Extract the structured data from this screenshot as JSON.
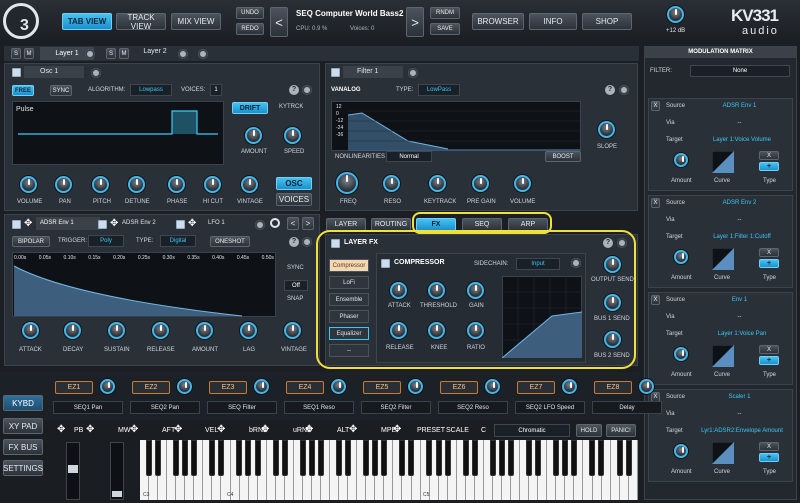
{
  "logo": {
    "badge": "3",
    "brand_top": "KV331",
    "brand_bottom": "audio"
  },
  "top": {
    "tab_view": "TAB VIEW",
    "track_view": "TRACK VIEW",
    "mix_view": "MIX VIEW",
    "undo": "UNDO",
    "redo": "REDO",
    "preset": "SEQ Computer World Bass2",
    "cpu": "CPU: 0.9 %",
    "voices": "Voices: 0",
    "rndm": "RNDM",
    "save": "SAVE",
    "browser": "BROWSER",
    "info": "INFO",
    "shop": "SHOP",
    "volume": "+12 dB"
  },
  "layers": {
    "s": "S",
    "m": "M",
    "layer1": "Layer 1",
    "layer2": "Layer 2"
  },
  "osc": {
    "title": "Osc 1",
    "free": "FREE",
    "sync": "SYNC",
    "algorithm_label": "ALGORITHM:",
    "algorithm": "Lowpass",
    "voices_label": "VOICES:",
    "voices": "1",
    "wave": "Pulse",
    "drift": "DRIFT",
    "kytrck": "KYTRCK",
    "amount": "AMOUNT",
    "speed": "SPEED",
    "knobs": [
      "VOLUME",
      "PAN",
      "PITCH",
      "DETUNE",
      "PHASE",
      "HI CUT",
      "VINTAGE"
    ],
    "osc_btn": "OSC",
    "voices_btn": "VOICES"
  },
  "filter": {
    "title": "Filter 1",
    "vanalog": "VANALOG",
    "type_label": "TYPE:",
    "type": "LowPass",
    "ticks": [
      "12",
      "0",
      "-12",
      "-24",
      "-36"
    ],
    "nonlin": "NONLINEARITIES",
    "normal": "Normal",
    "boost": "BOOST",
    "slope": "SLOPE",
    "knobs": [
      "FREQ",
      "RESO",
      "KEYTRACK",
      "PRE GAIN",
      "VOLUME"
    ]
  },
  "tabs": {
    "layer": "LAYER",
    "routing": "ROUTING",
    "fx": "FX",
    "seq": "SEQ",
    "arp": "ARP"
  },
  "env": {
    "env1": "ADSR Env 1",
    "env2": "ADSR Env 2",
    "lfo": "LFO 1",
    "bipolar": "BIPOLAR",
    "trigger_label": "TRIGGER:",
    "trigger": "Poly",
    "type_label": "TYPE:",
    "type": "Digital",
    "oneshot": "ONESHOT",
    "times": [
      "0.00s",
      "0.05s",
      "0.10s",
      "0.15s",
      "0.20s",
      "0.25s",
      "0.30s",
      "0.35s",
      "0.40s",
      "0.45s",
      "0.50s"
    ],
    "sync": "SYNC",
    "off": "Off",
    "snap": "SNAP",
    "knobs": [
      "ATTACK",
      "DECAY",
      "SUSTAIN",
      "RELEASE",
      "AMOUNT",
      "LAG",
      "VINTAGE"
    ]
  },
  "layerfx": {
    "title": "LAYER FX",
    "list": [
      "Compressor",
      "LoFi",
      "Ensemble",
      "Phaser",
      "Equalizer",
      "--"
    ],
    "comp_title": "COMPRESSOR",
    "sidechain_label": "SIDECHAIN:",
    "sidechain": "Input",
    "knobs_top": [
      "ATTACK",
      "THRESHOLD",
      "GAIN"
    ],
    "knobs_bottom": [
      "RELEASE",
      "KNEE",
      "RATIO"
    ],
    "out": [
      "OUTPUT SEND",
      "BUS 1 SEND",
      "BUS 2 SEND"
    ]
  },
  "mod": {
    "title": "MODULATION MATRIX",
    "filter_label": "FILTER:",
    "filter": "None",
    "source": "Source",
    "via": "Via",
    "target": "Target",
    "amount": "Amount",
    "curve": "Curve",
    "type": "Type",
    "dash": "--",
    "x": "X",
    "plus": "+",
    "slots": [
      {
        "source": "ADSR Env 1",
        "via": "--",
        "target": "Layer 1:Voice Volume"
      },
      {
        "source": "ADSR Env 2",
        "via": "--",
        "target": "Layer 1:Filter 1:Cutoff"
      },
      {
        "source": "Env 1",
        "via": "--",
        "target": "Layer 1:Voice Pan"
      },
      {
        "source": "Scaler 1",
        "via": "--",
        "target": "Lyr1:ADSR2:Envelope Amount"
      }
    ]
  },
  "ez": {
    "items": [
      "EZ1",
      "EZ2",
      "EZ3",
      "EZ4",
      "EZ5",
      "EZ6",
      "EZ7",
      "EZ8"
    ],
    "labels": [
      "SEQ1 Pan",
      "SEQ2 Pan",
      "SEQ Filter",
      "SEQ1 Reso",
      "SEQ2 Filter",
      "SEQ2 Reso",
      "SEQ2 LFO Speed",
      "Delay"
    ]
  },
  "side": {
    "kybd": "KYBD",
    "xypad": "XY PAD",
    "fxbus": "FX BUS",
    "settings": "SETTINGS"
  },
  "kb": {
    "pb": "PB",
    "mw": "MW",
    "aft": "AFT",
    "vel": "VEL",
    "brnd": "bRND",
    "urnd": "uRND",
    "alt": "ALT",
    "mpe": "MPE",
    "preset": "PRESET",
    "scale": "SCALE",
    "c": "C",
    "chromatic": "Chromatic",
    "hold": "HOLD",
    "panic": "PANIC!",
    "c3": "C3",
    "c4": "C4",
    "c5": "C5"
  }
}
